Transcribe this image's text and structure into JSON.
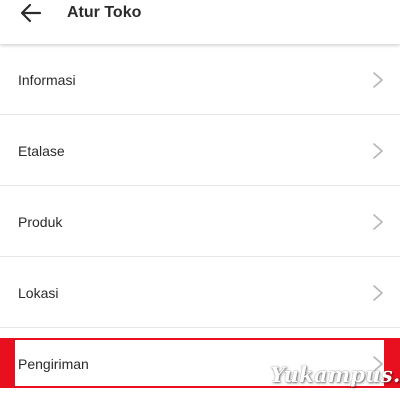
{
  "header": {
    "title": "Atur Toko",
    "back_icon": "arrow-left-icon"
  },
  "menu": {
    "items": [
      {
        "label": "Informasi"
      },
      {
        "label": "Etalase"
      },
      {
        "label": "Produk"
      },
      {
        "label": "Lokasi"
      },
      {
        "label": "Pengiriman",
        "highlighted": true
      }
    ],
    "chevron_icon": "chevron-right-icon"
  },
  "watermark": {
    "text": "Yukampus.com"
  },
  "colors": {
    "highlight": "#e8101f",
    "divider": "#e6e6e6",
    "chevron": "#b5b5b5",
    "text": "#2a2a2a"
  }
}
